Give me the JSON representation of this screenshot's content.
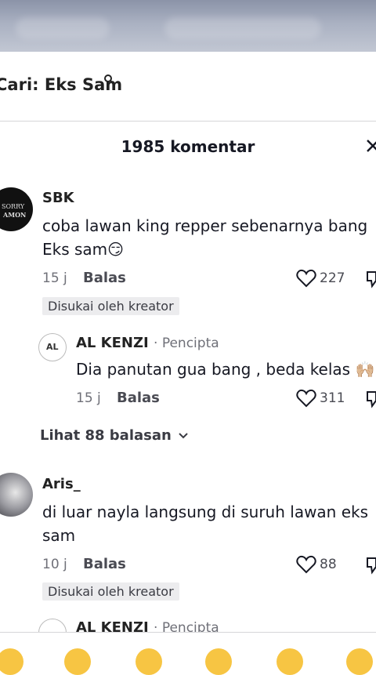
{
  "search": {
    "label": "Cari: Eks Sam"
  },
  "sheet": {
    "title": "1985 komentar"
  },
  "comments": [
    {
      "username": "SBK",
      "avatar_text_top": "SORRY",
      "avatar_text_bottom": "AMON",
      "text_line1": "coba lawan king repper sebenarnya bang",
      "text_line2": "Eks sam😏",
      "time": "15 j",
      "reply_label": "Balas",
      "likes": "227",
      "badge": "Disukai oleh kreator"
    },
    {
      "username": "AL  KENZI",
      "role": "· Pencipta",
      "avatar_text": "AL",
      "text_line1": "Dia panutan gua bang , beda kelas 🙌🏼",
      "time": "15 j",
      "reply_label": "Balas",
      "likes": "311"
    },
    {
      "username": "Aris_",
      "text_line1": "di luar nayla langsung di suruh lawan eks",
      "text_line2": "sam",
      "time": "10 j",
      "reply_label": "Balas",
      "likes": "88",
      "badge": "Disukai oleh kreator"
    },
    {
      "username": "AL  KENZI",
      "role": "· Pencipta"
    }
  ],
  "view_replies": "Lihat 88 balasan",
  "emoji_bar": [
    "grin",
    "hearts",
    "joy",
    "flushed",
    "smirk",
    "grin-sweat"
  ]
}
